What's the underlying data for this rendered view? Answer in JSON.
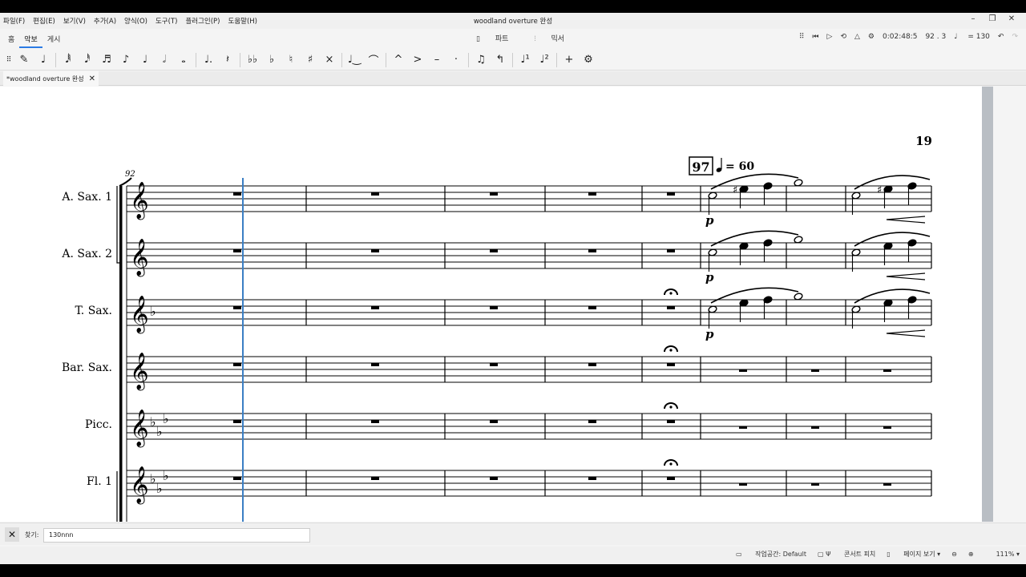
{
  "window": {
    "title": "woodland overture 완성",
    "menu": [
      "파일(F)",
      "편집(E)",
      "보기(V)",
      "추가(A)",
      "양식(O)",
      "도구(T)",
      "플러그인(P)",
      "도움말(H)"
    ],
    "controls": [
      "–",
      "❐",
      "✕"
    ]
  },
  "nav_tabs": [
    "홈",
    "악보",
    "게시"
  ],
  "center_tabs": {
    "parts": "파트",
    "mixer": "믹서"
  },
  "playback": {
    "time": "0:02:48:5",
    "position": "92 . 3",
    "tempo": "= 130"
  },
  "toolbar_icons": [
    "drag-handle-icon",
    "pencil-icon",
    "accent-pen-icon",
    "64th-note-icon",
    "32nd-note-icon",
    "16th-note-icon",
    "eighth-note-icon",
    "quarter-note-icon",
    "half-note-icon",
    "whole-note-icon",
    "dot-icon",
    "rest-icon",
    "double-flat-icon",
    "flat-icon",
    "natural-icon",
    "sharp-icon",
    "double-sharp-icon",
    "tie-icon",
    "slur-icon",
    "marcato-icon",
    "accent-icon",
    "tenuto-icon",
    "staccato-icon",
    "tuplet-icon",
    "flip-icon",
    "voice-1-icon",
    "voice-2-icon",
    "add-icon",
    "settings-icon"
  ],
  "doc_tab": {
    "label": "*woodland overture 완성"
  },
  "score": {
    "page_number": "19",
    "measure_start": "92",
    "rehearsal_mark": "97",
    "tempo_marking": "= 60",
    "instruments": [
      "A. Sax. 1",
      "A. Sax. 2",
      "T. Sax.",
      "Bar. Sax.",
      "Picc.",
      "Fl. 1"
    ],
    "dynamic": "p"
  },
  "find": {
    "label": "찾기:",
    "value": "130nnn"
  },
  "status": {
    "workspace": "작업공간: Default",
    "concert_pitch": "콘서트 피치",
    "page_view": "페이지 보기",
    "zoom": "111%"
  }
}
